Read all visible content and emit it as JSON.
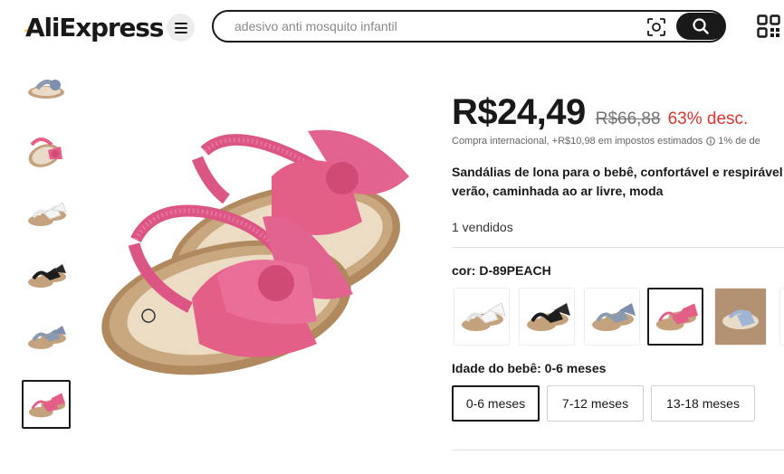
{
  "header": {
    "logo": "AliExpress",
    "search_placeholder": "adesivo anti mosquito infantil",
    "icons": [
      "menu-icon",
      "camera-icon",
      "search-icon",
      "qr-code-icon"
    ]
  },
  "gallery": {
    "thumbnails": [
      {
        "variant": "gray-blue",
        "icon": "sandal-icon"
      },
      {
        "variant": "pink",
        "icon": "sandal-icon"
      },
      {
        "variant": "white",
        "icon": "sandal-icon"
      },
      {
        "variant": "black",
        "icon": "sandal-icon"
      },
      {
        "variant": "blue-gray",
        "icon": "sandal-icon"
      },
      {
        "variant": "pink",
        "icon": "sandal-icon",
        "selected": true
      }
    ]
  },
  "product": {
    "price": "R$24,49",
    "old_price": "R$66,88",
    "discount": "63% desc.",
    "tax_prefix": "Compra internacional, +R$10,98 em impostos estimados",
    "tax_suffix": "1% de de",
    "title": "Sandálias de lona para o bebê, confortável e respirável\nverão, caminhada ao ar livre, moda",
    "sold": "1 vendidos",
    "color_label": "cor: D-89PEACH",
    "colors": [
      {
        "name": "white",
        "color": "#f2f2f2"
      },
      {
        "name": "black",
        "color": "#1d1d1d"
      },
      {
        "name": "gray-blue",
        "color": "#8a9bb0"
      },
      {
        "name": "peach",
        "color": "#e45f88",
        "selected": true
      },
      {
        "name": "blue-on-wood",
        "color": "#9fb5d6"
      }
    ],
    "age_label": "Idade do bebê: 0-6 meses",
    "age_options": [
      "0-6 meses",
      "7-12 meses",
      "13-18 meses"
    ],
    "age_selected": "0-6 meses"
  },
  "colors": {
    "text": "#191919",
    "discount": "#e2322e",
    "muted": "#757575",
    "logo_accent": "#fdb22a",
    "product_pink": "#e45f88",
    "sole_tan": "#c4a27d"
  }
}
